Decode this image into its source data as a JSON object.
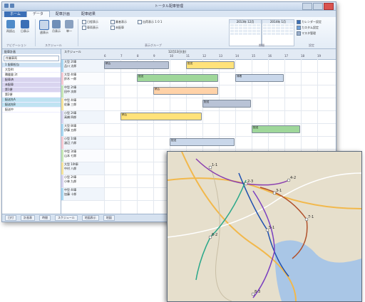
{
  "window": {
    "title": "トータル配車管理"
  },
  "tabs": [
    "ホーム",
    "データ",
    "配車計画",
    "配車結果"
  ],
  "ribbon": {
    "groups": [
      "ナビゲーション",
      "スケジュール",
      "表示グループ",
      "期間",
      "設定"
    ],
    "buttons": [
      "再読込",
      "日表示",
      "週表示",
      "月表示",
      "単一"
    ],
    "filters": [
      "日程表示",
      "車両表示",
      "業者表示",
      "未配車",
      "出荷表示 1 0 1"
    ],
    "right_buttons": [
      "カレンダー設定",
      "カスタム設定",
      "マスタ管理"
    ],
    "calendar_months": [
      "2013年 12月",
      "2014年 1月"
    ]
  },
  "left_panel": {
    "header": "配車計画",
    "selector": "作業車両",
    "items": [
      "1 配車担当",
      "大型4t",
      "積載量 2t",
      "配車済",
      "未配車",
      "第1便",
      "第2便",
      "配送先A",
      "配送先B",
      "配送中"
    ]
  },
  "schedule": {
    "header": "スケジュール",
    "date_label": "12月13日(金)",
    "times": [
      "6",
      "7",
      "8",
      "9",
      "10",
      "11",
      "12",
      "13",
      "14",
      "15",
      "16",
      "17",
      "18",
      "19"
    ],
    "rows": [
      {
        "label": "大型 2t車",
        "sub": "品川 太郎"
      },
      {
        "label": "大型 4t車",
        "sub": "鈴木 一郎"
      },
      {
        "label": "中型 2t車",
        "sub": "田中 次郎"
      },
      {
        "label": "中型 4t車",
        "sub": "佐藤 三郎"
      },
      {
        "label": "小型 2t車",
        "sub": "高橋 四郎"
      },
      {
        "label": "大型 8t車",
        "sub": "伊藤 五郎"
      },
      {
        "label": "小型 1t車",
        "sub": "渡辺 六郎"
      },
      {
        "label": "中型 3t車",
        "sub": "山本 七郎"
      },
      {
        "label": "大型 10t車",
        "sub": "中村 八郎"
      },
      {
        "label": "小型 2t車",
        "sub": "小林 九郎"
      },
      {
        "label": "中型 4t車",
        "sub": "加藤 十郎"
      }
    ],
    "tasks": [
      {
        "row": 0,
        "label": "積込"
      },
      {
        "row": 0,
        "label": "配送"
      },
      {
        "row": 1,
        "label": "配送"
      },
      {
        "row": 1,
        "label": "帰着"
      },
      {
        "row": 2,
        "label": "積込"
      },
      {
        "row": 3,
        "label": "配送"
      },
      {
        "row": 4,
        "label": "積込"
      },
      {
        "row": 5,
        "label": "配送"
      },
      {
        "row": 6,
        "label": "配送"
      },
      {
        "row": 7,
        "label": "積込"
      }
    ]
  },
  "status": [
    "日付",
    "計画表",
    "時間",
    "スケジュール",
    "地図表示",
    "地図"
  ],
  "colors": {
    "ribbon": "#e3ecf6",
    "accent": "#3b6fb6",
    "taskA": "#b9c3d6",
    "taskB": "#ffe27a",
    "taskC": "#9fd79a",
    "rowBlue": "#a9d8f2",
    "rowPink": "#f6c9d1"
  },
  "map": {
    "labels": [
      "1-1",
      "2-3",
      "3-1",
      "4-2",
      "5-1",
      "6-2",
      "7-1",
      "8-3"
    ]
  }
}
